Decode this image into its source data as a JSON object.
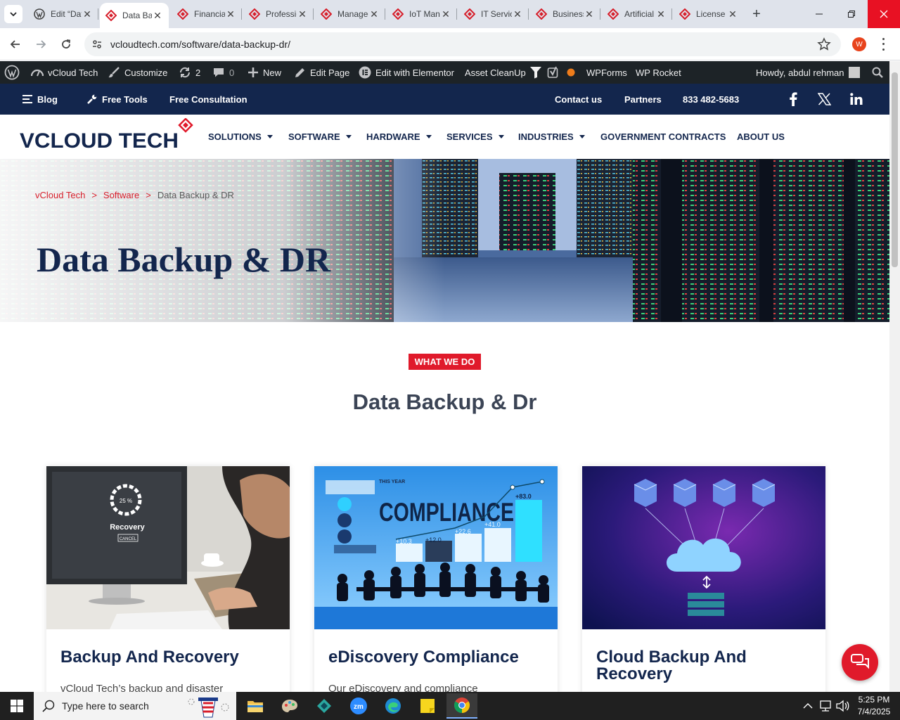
{
  "browser": {
    "tabs": [
      {
        "title": "Edit “Data Backup"
      },
      {
        "title": "Data Backup & DR"
      },
      {
        "title": "Financial Services"
      },
      {
        "title": "Professional Services"
      },
      {
        "title": "Managed Services"
      },
      {
        "title": "IoT Management"
      },
      {
        "title": "IT Services"
      },
      {
        "title": "Business Continuity"
      },
      {
        "title": "Artificial Intelligence"
      },
      {
        "title": "License Management"
      }
    ],
    "url": "vcloudtech.com/software/data-backup-dr/",
    "profile_initial": "W"
  },
  "wp_admin_bar": {
    "site_name": "vCloud Tech",
    "customize": "Customize",
    "updates_count": "2",
    "comments_count": "0",
    "new": "New",
    "edit_page": "Edit Page",
    "elementor": "Edit with Elementor",
    "asset_cleanup": "Asset CleanUp",
    "wpforms": "WPForms",
    "wp_rocket": "WP Rocket",
    "howdy": "Howdy, abdul rehman"
  },
  "site_topbar": {
    "blog": "Blog",
    "free_tools": "Free Tools",
    "free_consultation": "Free Consultation",
    "contact_us": "Contact us",
    "partners": "Partners",
    "phone": "833 482-5683"
  },
  "logo": {
    "text": "VCLOUD TECH"
  },
  "main_nav": [
    {
      "label": "SOLUTIONS"
    },
    {
      "label": "SOFTWARE"
    },
    {
      "label": "HARDWARE"
    },
    {
      "label": "SERVICES"
    },
    {
      "label": "INDUSTRIES"
    },
    {
      "label": "GOVERNMENT CONTRACTS"
    },
    {
      "label": "ABOUT US"
    }
  ],
  "breadcrumb": {
    "home": "vCloud Tech",
    "sep": ">",
    "parent": "Software",
    "current": "Data Backup & DR"
  },
  "hero": {
    "title": "Data Backup & DR"
  },
  "section": {
    "badge": "WHAT WE DO",
    "title": "Data Backup & Dr"
  },
  "cards": [
    {
      "title": "Backup And Recovery",
      "desc": "vCloud Tech’s backup and disaster",
      "img_percent": "25 %",
      "img_word": "Recovery",
      "img_cancel": "CANCEL"
    },
    {
      "title": "eDiscovery Compliance",
      "desc": "Our eDiscovery and compliance",
      "img_word": "COMPLIANCE",
      "img_year": "THIS YEAR",
      "img_vals": [
        "+10.3",
        "+12.0",
        "+22.6",
        "+41.0",
        "+83.0"
      ]
    },
    {
      "title": "Cloud Backup And Recovery",
      "desc": ""
    }
  ],
  "taskbar": {
    "search_placeholder": "Type here to search",
    "time": "5:25 PM",
    "date": "7/4/2025",
    "zoom_label": "zm"
  },
  "colors": {
    "navy": "#13264d",
    "accent_red": "#e01a2b",
    "admin_bar": "#1d2327"
  }
}
